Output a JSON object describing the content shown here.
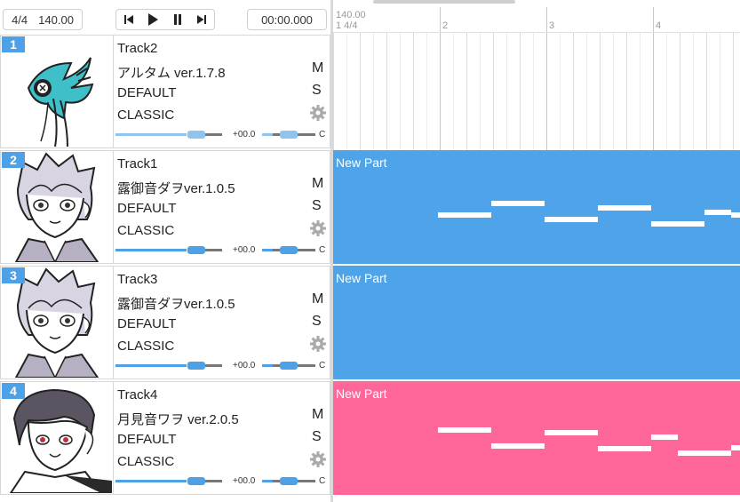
{
  "toolbar": {
    "time_signature": "4/4",
    "tempo": "140.00",
    "position": "00:00.000",
    "transport": [
      "go-to-start-icon",
      "play-icon",
      "pause-icon",
      "go-to-end-icon"
    ]
  },
  "timeline": {
    "tempo_marker": "140.00",
    "signature_marker": "1 4/4",
    "bars": [
      "2",
      "3",
      "4"
    ]
  },
  "tracks": [
    {
      "number": "1",
      "name": "Track2",
      "singer": "アルタム ver.1.7.8",
      "renderer": "DEFAULT",
      "mode": "CLASSIC",
      "mute": "M",
      "solo": "S",
      "volume_label": "+00.0",
      "pan_label": "C",
      "slider_color": "#8fc4ee",
      "volume_level": 0.68,
      "pan_level": 0.5,
      "part": null
    },
    {
      "number": "2",
      "name": "Track1",
      "singer": "露御音ダヲver.1.0.5",
      "renderer": "DEFAULT",
      "mode": "CLASSIC",
      "mute": "M",
      "solo": "S",
      "volume_label": "+00.0",
      "pan_label": "C",
      "slider_color": "#4ea1e6",
      "volume_level": 0.68,
      "pan_level": 0.5,
      "part": {
        "label": "New Part",
        "color": "#4fa3e8"
      }
    },
    {
      "number": "3",
      "name": "Track3",
      "singer": "露御音ダヲver.1.0.5",
      "renderer": "DEFAULT",
      "mode": "CLASSIC",
      "mute": "M",
      "solo": "S",
      "volume_label": "+00.0",
      "pan_label": "C",
      "slider_color": "#4ea1e6",
      "volume_level": 0.68,
      "pan_level": 0.5,
      "part": {
        "label": "New Part",
        "color": "#4fa3e8"
      }
    },
    {
      "number": "4",
      "name": "Track4",
      "singer": "月見音ワヲ ver.2.0.5",
      "renderer": "DEFAULT",
      "mode": "CLASSIC",
      "mute": "M",
      "solo": "S",
      "volume_label": "+00.0",
      "pan_label": "C",
      "slider_color": "#4ea1e6",
      "volume_level": 0.68,
      "pan_level": 0.5,
      "part": {
        "label": "New Part",
        "color": "#ff6699"
      }
    }
  ],
  "colors": {
    "accent": "#4ea1e6",
    "part_blue": "#4fa3e8",
    "part_pink": "#ff6699"
  }
}
